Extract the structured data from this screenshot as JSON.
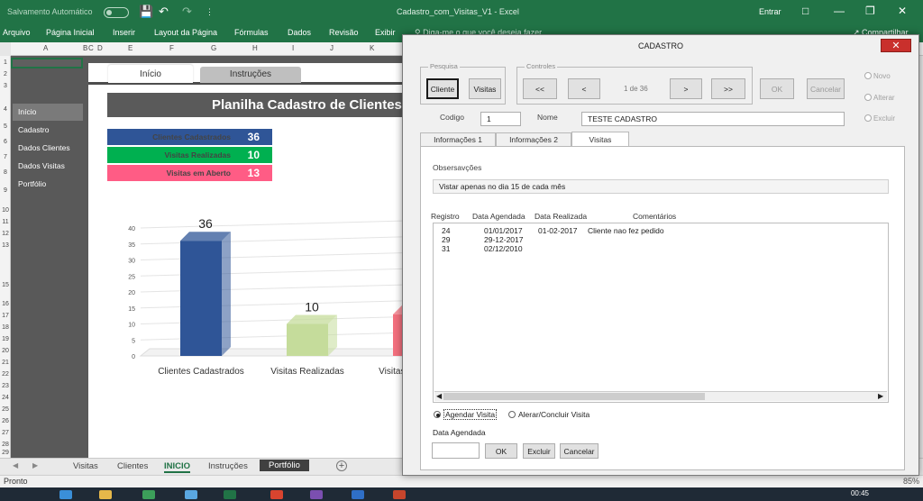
{
  "titlebar": {
    "autosave": "Salvamento Automático",
    "doc_title": "Cadastro_com_Visitas_V1  -  Excel",
    "signin": "Entrar"
  },
  "ribbon": {
    "tabs": [
      "Arquivo",
      "Página Inicial",
      "Inserir",
      "Layout da Página",
      "Fórmulas",
      "Dados",
      "Revisão",
      "Exibir"
    ],
    "tell_me": "Diga-me o que você deseja fazer",
    "share": "Compartilhar"
  },
  "columns": [
    "A",
    "B",
    "C",
    "D",
    "E",
    "F",
    "G",
    "H",
    "I",
    "J",
    "K"
  ],
  "rows": [
    "1",
    "2",
    "3",
    "4",
    "5",
    "6",
    "7",
    "8",
    "9",
    "10",
    "11",
    "12",
    "13",
    "15",
    "16",
    "17",
    "18",
    "19",
    "20",
    "21",
    "22",
    "23",
    "24",
    "25",
    "26",
    "27",
    "28",
    "29"
  ],
  "sidebar": {
    "items": [
      {
        "label": "Início",
        "active": true
      },
      {
        "label": "Cadastro",
        "active": false
      },
      {
        "label": "Dados Clientes",
        "active": false
      },
      {
        "label": "Dados Visitas",
        "active": false
      },
      {
        "label": "Portfólio",
        "active": false
      }
    ]
  },
  "sheet_tabs_top": {
    "inicio": "Início",
    "instrucoes": "Instruções"
  },
  "banner": "Planilha Cadastro de Clientes",
  "kpis": [
    {
      "label": "Clientes Cadastrados",
      "value": "36",
      "color": "#2f5597"
    },
    {
      "label": "Visitas Realizadas",
      "value": "10",
      "color": "#00b050"
    },
    {
      "label": "Visitas em Aberto",
      "value": "13",
      "color": "#ff5c85"
    }
  ],
  "chart_data": {
    "type": "bar",
    "categories": [
      "Clientes Cadastrados",
      "Visitas Realizadas",
      "Visitas em Aberto"
    ],
    "values": [
      36,
      10,
      13
    ],
    "colors": [
      "#2f5597",
      "#c5dc9b",
      "#f3707e"
    ],
    "yticks": [
      0,
      5,
      10,
      15,
      20,
      25,
      30,
      35,
      40
    ],
    "ylim": [
      0,
      40
    ],
    "grid": true
  },
  "sheet_tabs": [
    "Visitas",
    "Clientes",
    "INICIO",
    "Instruções",
    "Portfólio"
  ],
  "active_sheet": "INICIO",
  "status": {
    "ready": "Pronto",
    "zoom": "85%"
  },
  "clock": "00:45",
  "dialog": {
    "title": "CADASTRO",
    "close": "✕",
    "pesquisa": {
      "caption": "Pesquisa",
      "cliente": "Cliente",
      "visitas": "Visitas"
    },
    "controles": {
      "caption": "Controles",
      "first": "<<",
      "prev": "<",
      "page": "1 de 36",
      "next": ">",
      "last": ">>",
      "ok": "OK",
      "cancel": "Cancelar"
    },
    "mode": {
      "novo": "Novo",
      "alterar": "Alterar",
      "excluir": "Excluir"
    },
    "codigo_label": "Codigo",
    "codigo_value": "1",
    "nome_label": "Nome",
    "nome_value": "TESTE CADASTRO",
    "tabs": [
      "Informações 1",
      "Informações 2",
      "Visitas"
    ],
    "obs_label": "Obsersavções",
    "obs_value": "Vistar apenas no dia 15 de cada mês",
    "list_headers": {
      "registro": "Registro",
      "agendada": "Data Agendada",
      "realizada": "Data Realizada",
      "comentarios": "Comentários"
    },
    "list_rows": [
      {
        "registro": "24",
        "agendada": "01/01/2017",
        "realizada": "01-02-2017",
        "comentario": "Cliente nao fez pedido"
      },
      {
        "registro": "29",
        "agendada": "29-12-2017",
        "realizada": "",
        "comentario": ""
      },
      {
        "registro": "31",
        "agendada": "02/12/2010",
        "realizada": "",
        "comentario": ""
      }
    ],
    "opt_agendar": "Agendar Visita",
    "opt_alterar": "Alerar/Concluir Visita",
    "data_agendada_label": "Data Agendada",
    "btn_ok": "OK",
    "btn_excluir": "Excluir",
    "btn_cancelar": "Cancelar"
  }
}
